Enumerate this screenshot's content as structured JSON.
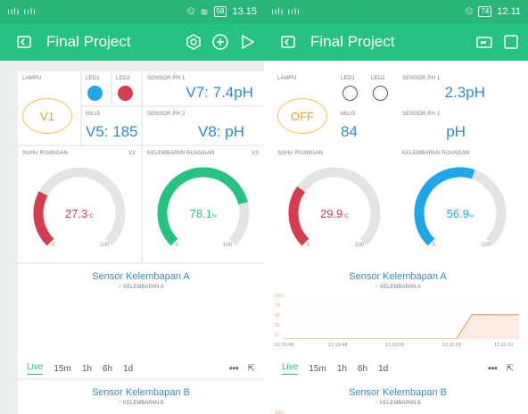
{
  "status_left": {
    "signal": "ıılı ıılı",
    "time": "13.15",
    "battery": "58"
  },
  "status_right": {
    "signal": "ıılı ıılı",
    "time": "12.11",
    "battery": "74"
  },
  "app": {
    "title_left": "Final Project",
    "title_right": "Final Project"
  },
  "left": {
    "lampu": {
      "label": "LAMPU",
      "value": "V1"
    },
    "led1": {
      "label": "LED1",
      "color": "#1ea7e8"
    },
    "led2": {
      "label": "LED2",
      "color": "#d63c4f"
    },
    "ph1": {
      "label": "SENSOR PH 1",
      "value": "V7: 7.4pH"
    },
    "milis": {
      "label": "MILIS",
      "value": "V5: 185"
    },
    "ph2": {
      "label": "SENSOR PH 2",
      "value": "V8: pH"
    },
    "suhu": {
      "label": "SUHU RUANGAN",
      "pin": "V2",
      "value": "27.3",
      "unit": "°C",
      "min": "0",
      "max": "100",
      "level": 27.3,
      "color": "#d63c4f"
    },
    "kelembapan": {
      "label": "KELEMBAPAN RUANGAN",
      "pin": "V3",
      "value": "78.1",
      "unit": "%",
      "min": "0",
      "max": "100",
      "level": 78.1,
      "color": "#26c281"
    },
    "chart_a": {
      "title": "Sensor Kelembapan A",
      "legend": "KELEMBAPAN A"
    },
    "range": [
      "Live",
      "15m",
      "1h",
      "6h",
      "1d"
    ],
    "more": "•••",
    "chart_b": {
      "title": "Sensor Kelembapan B",
      "legend": "KELEMBAPAN B"
    }
  },
  "right": {
    "lampu": {
      "label": "LAMPU",
      "value": "OFF"
    },
    "led1": {
      "label": "LED1"
    },
    "led2": {
      "label": "LED2"
    },
    "ph1": {
      "label": "SENSOR PH 1",
      "value": "2.3pH"
    },
    "milis": {
      "label": "MILIS",
      "value": "84"
    },
    "ph2": {
      "label": "SENSOR PH 2",
      "value": "pH"
    },
    "suhu": {
      "label": "SUHU RUANGAN",
      "value": "29.9",
      "unit": "°C",
      "min": "0",
      "max": "100",
      "level": 29.9,
      "color": "#d63c4f"
    },
    "kelembapan": {
      "label": "KELEMBAPAN RUANGAN",
      "value": "56.9",
      "unit": "%",
      "min": "0",
      "max": "100",
      "level": 56.9,
      "color": "#1ea7e8"
    },
    "chart_a": {
      "title": "Sensor Kelembapan A",
      "legend": "KELEMBAPAN A",
      "y_ticks": [
        "100",
        "75",
        "50",
        "25",
        "0"
      ],
      "x_ticks": [
        "12:10:40",
        "12:10:48",
        "12:10:55",
        "12:11:03",
        "12:11:10"
      ]
    },
    "range": [
      "Live",
      "15m",
      "1h",
      "6h",
      "1d"
    ],
    "more": "•••",
    "chart_b": {
      "title": "Sensor Kelembapan B",
      "legend": "KELEMBAPAN B",
      "y_top": "100"
    }
  },
  "chart_data": {
    "type": "line",
    "title": "Sensor Kelembapan A",
    "series": [
      {
        "name": "KELEMBAPAN A",
        "values": [
          0,
          0,
          0,
          0,
          0,
          0,
          0,
          0,
          0,
          0,
          0,
          0,
          57,
          57,
          56.5,
          56.9
        ]
      }
    ],
    "x_ticks": [
      "12:10:40",
      "12:10:48",
      "12:10:55",
      "12:11:03",
      "12:11:10"
    ],
    "ylim": [
      0,
      100
    ],
    "color": "#f0a070"
  }
}
